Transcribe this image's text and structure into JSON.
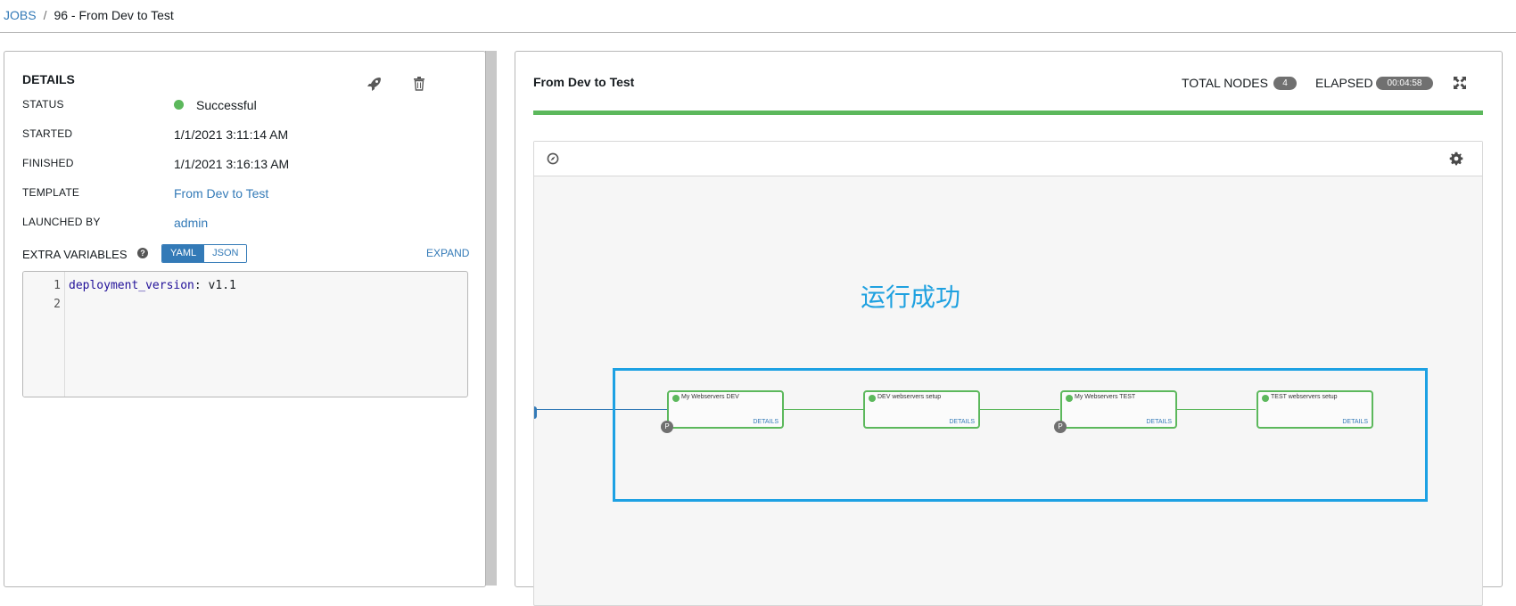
{
  "breadcrumb": {
    "jobs": "JOBS",
    "separator": "/",
    "current": "96 - From Dev to Test"
  },
  "details": {
    "title": "DETAILS",
    "status_label": "STATUS",
    "status_value": "Successful",
    "started_label": "STARTED",
    "started_value": "1/1/2021 3:11:14 AM",
    "finished_label": "FINISHED",
    "finished_value": "1/1/2021 3:16:13 AM",
    "template_label": "TEMPLATE",
    "template_value": "From Dev to Test",
    "launched_label": "LAUNCHED BY",
    "launched_value": "admin",
    "extra_vars_label": "EXTRA VARIABLES",
    "help_glyph": "?",
    "toggle": {
      "yaml": "YAML",
      "json": "JSON",
      "selected": "YAML"
    },
    "expand": "EXPAND",
    "code": {
      "line_numbers": [
        "1",
        "2"
      ],
      "key": "deployment_version",
      "colon": ":",
      "value": " v1.1"
    },
    "icons": {
      "relaunch": "rocket-icon",
      "delete": "trash-icon"
    }
  },
  "workflow": {
    "title": "From Dev to Test",
    "total_nodes_label": "TOTAL NODES",
    "total_nodes": "4",
    "elapsed_label": "ELAPSED",
    "elapsed": "00:04:58",
    "progress": 1.0,
    "success_annotation": "运行成功",
    "nodes": [
      {
        "name": "My Webservers DEV",
        "details": "DETAILS",
        "badge": "P"
      },
      {
        "name": "DEV webservers setup",
        "details": "DETAILS",
        "badge": ""
      },
      {
        "name": "My Webservers TEST",
        "details": "DETAILS",
        "badge": "P"
      },
      {
        "name": "TEST webservers setup",
        "details": "DETAILS",
        "badge": ""
      }
    ],
    "icons": {
      "fullscreen": "expand-arrows-icon",
      "compass": "compass-icon",
      "settings": "gear-icon"
    }
  },
  "colors": {
    "link": "#337ab7",
    "success": "#5cb85c",
    "annotation": "#1da1e3",
    "badge": "#707070"
  }
}
